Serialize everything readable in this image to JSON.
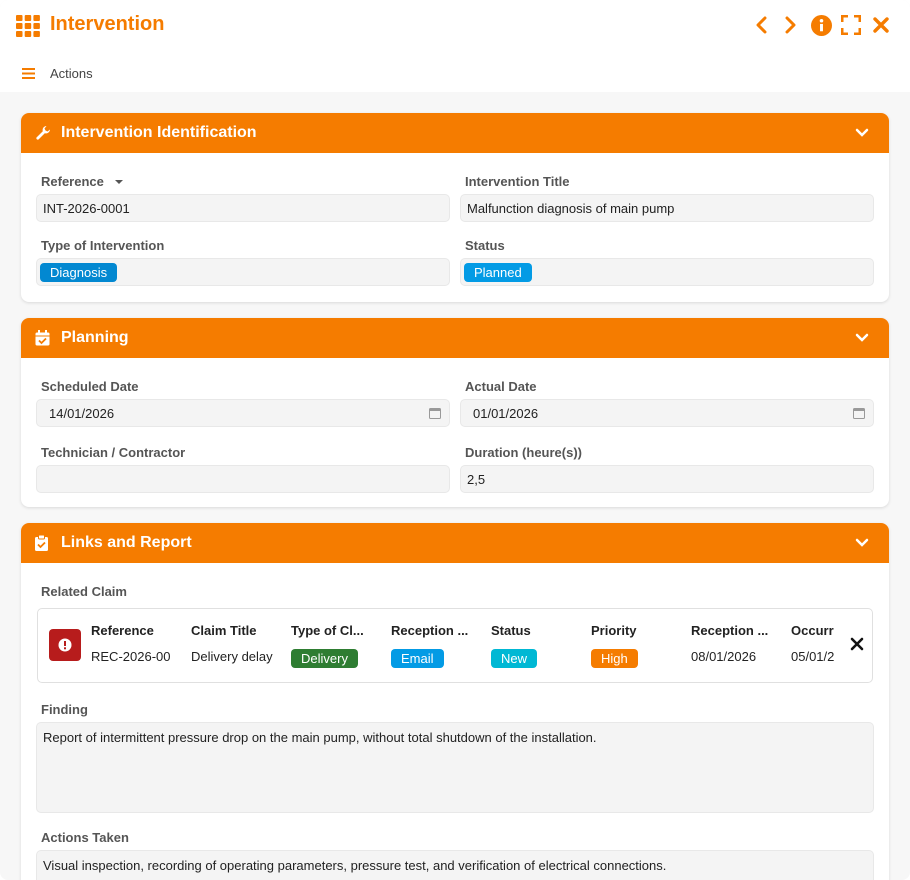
{
  "window": {
    "title": "Intervention"
  },
  "toolbar": {
    "actions_label": "Actions"
  },
  "colors": {
    "accent": "#f57c00",
    "diagnosis": "#0288d1",
    "planned": "#039be5",
    "delivery": "#2e7d32",
    "email": "#039be5",
    "new": "#00b8d4",
    "high": "#f57c00",
    "claim_badge": "#b71c1c"
  },
  "identification": {
    "header": "Intervention Identification",
    "reference_label": "Reference",
    "reference_value": "INT-2026-0001",
    "title_label": "Intervention Title",
    "title_value": "Malfunction diagnosis of main pump",
    "type_label": "Type of Intervention",
    "type_value": "Diagnosis",
    "status_label": "Status",
    "status_value": "Planned"
  },
  "planning": {
    "header": "Planning",
    "scheduled_label": "Scheduled Date",
    "scheduled_value": "14/01/2026",
    "actual_label": "Actual Date",
    "actual_value": "01/01/2026",
    "technician_label": "Technician / Contractor",
    "technician_value": "",
    "duration_label": "Duration (heure(s))",
    "duration_value": "2,5"
  },
  "links": {
    "header": "Links and Report",
    "related_claim_label": "Related Claim",
    "claim": {
      "columns": [
        "Reference",
        "Claim Title",
        "Type of Cl...",
        "Reception ...",
        "Status",
        "Priority",
        "Reception ...",
        "Occurr"
      ],
      "reference": "REC-2026-00",
      "title": "Delivery delay",
      "type": "Delivery",
      "reception_channel": "Email",
      "status": "New",
      "priority": "High",
      "reception_date": "08/01/2026",
      "occurrence": "05/01/2"
    },
    "finding_label": "Finding",
    "finding_value": "Report of intermittent pressure drop on the main pump, without total shutdown of the installation.",
    "actions_label": "Actions Taken",
    "actions_value": "Visual inspection, recording of operating parameters, pressure test, and verification of electrical connections."
  }
}
